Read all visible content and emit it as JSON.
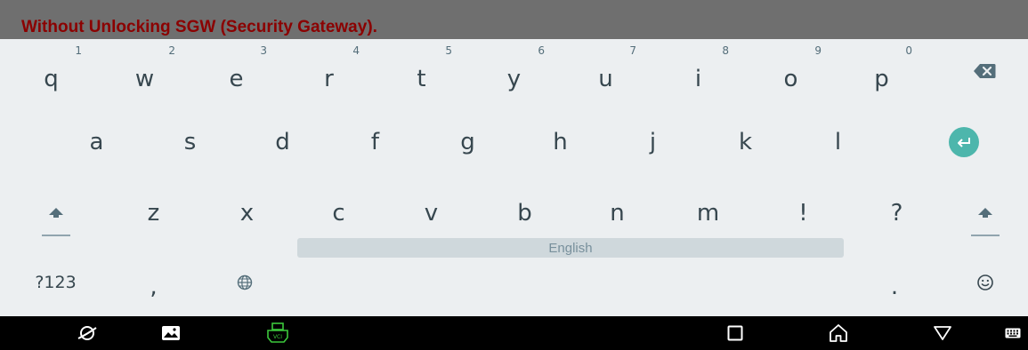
{
  "banner": {
    "message": "Without Unlocking SGW (Security Gateway)."
  },
  "keyboard": {
    "row1": [
      {
        "label": "q",
        "hint": "1"
      },
      {
        "label": "w",
        "hint": "2"
      },
      {
        "label": "e",
        "hint": "3"
      },
      {
        "label": "r",
        "hint": "4"
      },
      {
        "label": "t",
        "hint": "5"
      },
      {
        "label": "y",
        "hint": "6"
      },
      {
        "label": "u",
        "hint": "7"
      },
      {
        "label": "i",
        "hint": "8"
      },
      {
        "label": "o",
        "hint": "9"
      },
      {
        "label": "p",
        "hint": "0"
      }
    ],
    "row2": [
      "a",
      "s",
      "d",
      "f",
      "g",
      "h",
      "j",
      "k",
      "l"
    ],
    "row3": [
      "z",
      "x",
      "c",
      "v",
      "b",
      "n",
      "m",
      "!",
      "?"
    ],
    "symbols_label": "?123",
    "comma": ",",
    "period": ".",
    "space_label": "English",
    "icons": {
      "backspace": "backspace-icon",
      "enter": "enter-icon",
      "shift": "shift-icon",
      "globe": "globe-icon",
      "emoji": "emoji-icon"
    },
    "enter_color": "#4db6ac"
  },
  "navbar": {
    "icons": [
      "browser-icon",
      "gallery-icon",
      "vci-icon",
      "recent-apps-icon",
      "home-icon",
      "back-icon",
      "keyboard-icon"
    ],
    "vci_label": "VCI",
    "vci_color": "#3cc83c"
  }
}
